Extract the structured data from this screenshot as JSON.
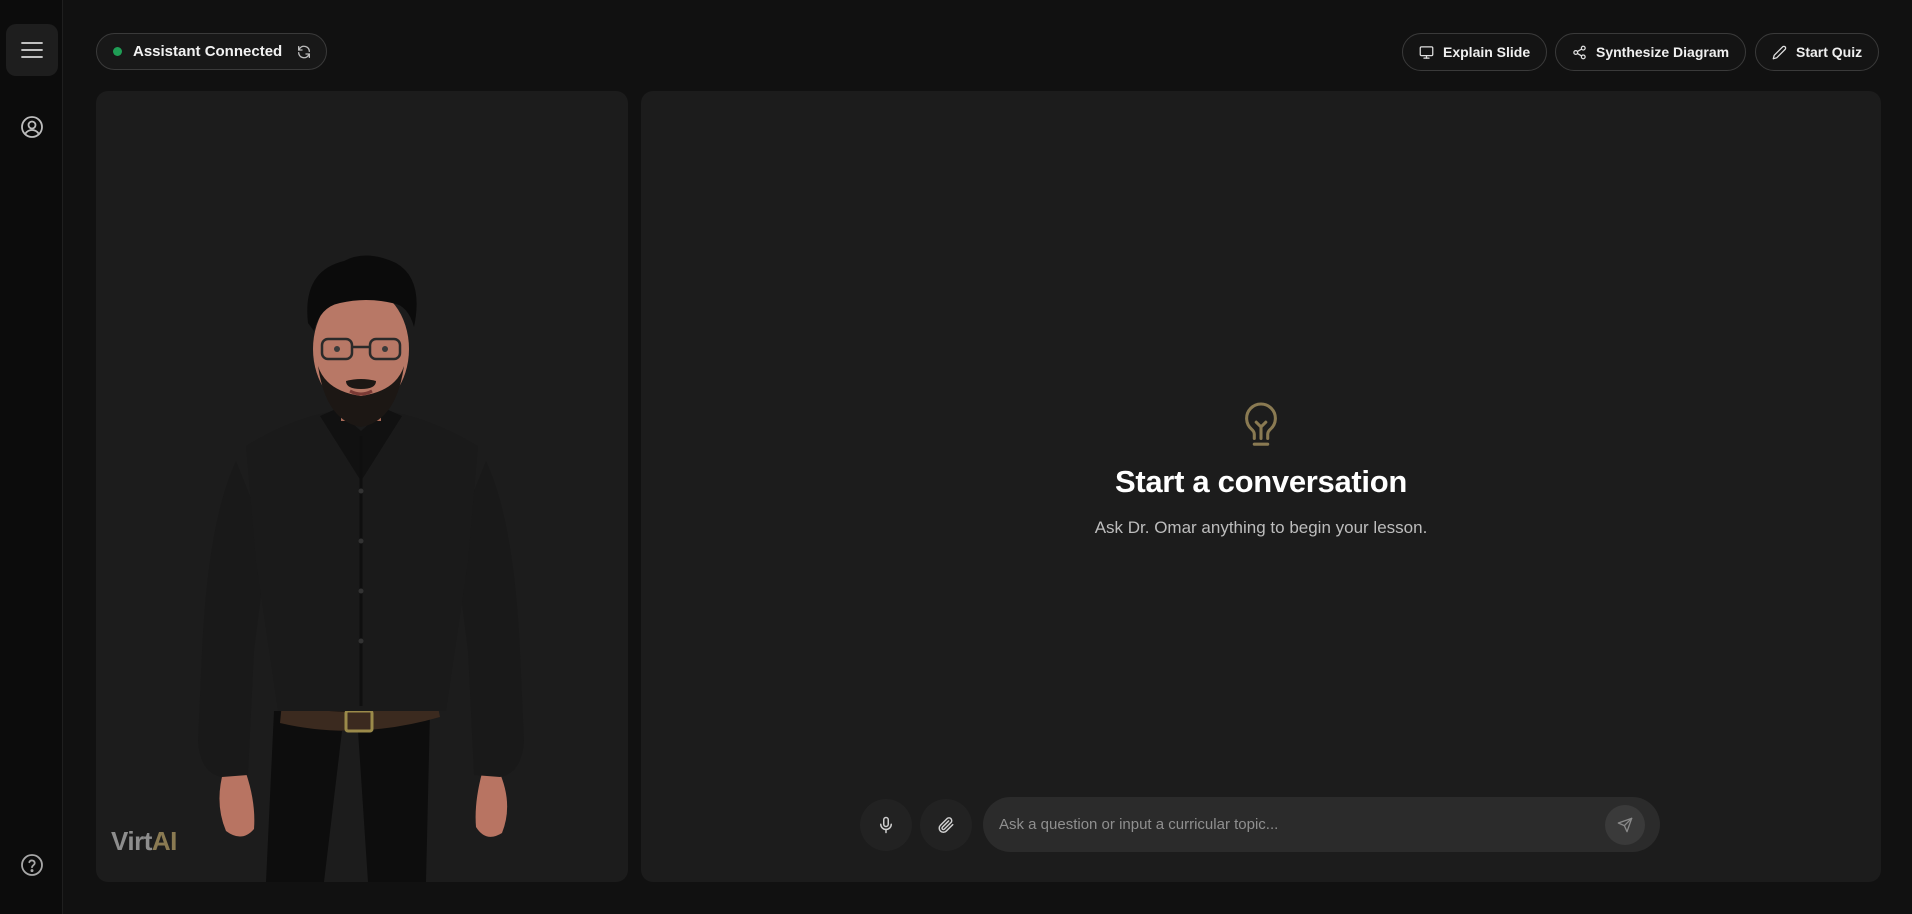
{
  "status": {
    "label": "Assistant Connected",
    "dot_color": "#1f9d55"
  },
  "toolbar": {
    "explain_label": "Explain Slide",
    "synthesize_label": "Synthesize Diagram",
    "quiz_label": "Start Quiz"
  },
  "brand": {
    "part1": "Virt",
    "part2": "AI",
    "accent": "#8a7a52"
  },
  "empty_state": {
    "title": "Start a conversation",
    "subtitle": "Ask Dr. Omar anything to begin your lesson."
  },
  "chat": {
    "placeholder": "Ask a question or input a curricular topic..."
  },
  "icons": {
    "menu": "menu-icon",
    "profile": "user-circle-icon",
    "help": "help-circle-icon",
    "refresh": "refresh-icon",
    "slide": "monitor-icon",
    "diagram": "share-nodes-icon",
    "quiz": "pencil-icon",
    "bulb": "lightbulb-icon",
    "mic": "microphone-icon",
    "attach": "paperclip-icon",
    "send": "send-icon"
  }
}
